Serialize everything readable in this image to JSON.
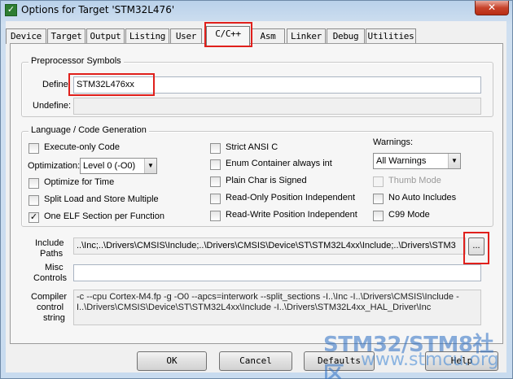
{
  "window": {
    "title": "Options for Target 'STM32L476'",
    "close_glyph": "✕"
  },
  "tabs": [
    "Device",
    "Target",
    "Output",
    "Listing",
    "User",
    "C/C++",
    "Asm",
    "Linker",
    "Debug",
    "Utilities"
  ],
  "active_tab": "C/C++",
  "preprocessor": {
    "title": "Preprocessor Symbols",
    "define_label": "Define:",
    "define_value": "STM32L476xx",
    "undefine_label": "Undefine:",
    "undefine_value": ""
  },
  "codegen": {
    "title": "Language / Code Generation",
    "execute_only": {
      "label": "Execute-only Code",
      "checked": false
    },
    "optimization_label": "Optimization:",
    "optimization_value": "Level 0 (-O0)",
    "optimize_time": {
      "label": "Optimize for Time",
      "checked": false
    },
    "split_load": {
      "label": "Split Load and Store Multiple",
      "checked": false
    },
    "one_elf": {
      "label": "One ELF Section per Function",
      "checked": true
    },
    "strict_ansi": {
      "label": "Strict ANSI C",
      "checked": false
    },
    "enum_container": {
      "label": "Enum Container always int",
      "checked": false
    },
    "plain_char": {
      "label": "Plain Char is Signed",
      "checked": false
    },
    "ropi": {
      "label": "Read-Only Position Independent",
      "checked": false
    },
    "rwpi": {
      "label": "Read-Write Position Independent",
      "checked": false
    },
    "warnings_label": "Warnings:",
    "warnings_value": "All Warnings",
    "thumb_mode": {
      "label": "Thumb Mode",
      "checked": false
    },
    "no_auto_includes": {
      "label": "No Auto Includes",
      "checked": false
    },
    "c99": {
      "label": "C99 Mode",
      "checked": false
    }
  },
  "include_paths": {
    "label_line1": "Include",
    "label_line2": "Paths",
    "value": "..\\Inc;..\\Drivers\\CMSIS\\Include;..\\Drivers\\CMSIS\\Device\\ST\\STM32L4xx\\Include;..\\Drivers\\STM3",
    "browse_label": "..."
  },
  "misc_controls": {
    "label_line1": "Misc",
    "label_line2": "Controls",
    "value": ""
  },
  "compiler_control": {
    "label_line1": "Compiler",
    "label_line2": "control",
    "label_line3": "string",
    "value": "-c --cpu Cortex-M4.fp -g -O0 --apcs=interwork --split_sections -I..\\Inc -I..\\Drivers\\CMSIS\\Include -I..\\Drivers\\CMSIS\\Device\\ST\\STM32L4xx\\Include -I..\\Drivers\\STM32L4xx_HAL_Driver\\Inc"
  },
  "buttons": {
    "ok": "OK",
    "cancel": "Cancel",
    "defaults": "Defaults",
    "help": "Help"
  },
  "watermark": {
    "line1": "STM32/STM8社区",
    "line2": "www.stmcu.org"
  },
  "colors": {
    "highlight_red": "#e0201c"
  }
}
